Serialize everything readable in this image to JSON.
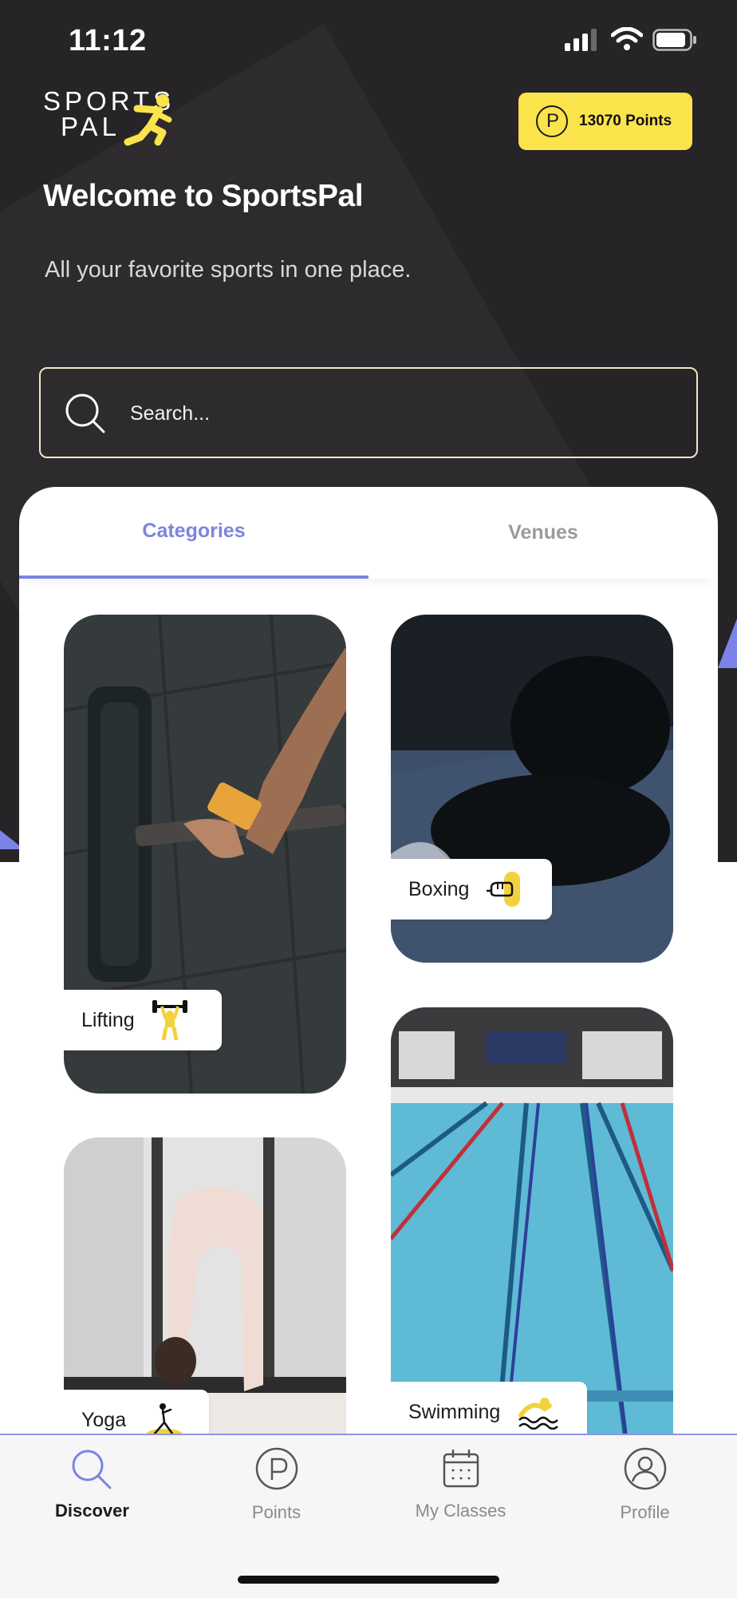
{
  "status_bar": {
    "time": "11:12"
  },
  "brand": {
    "logo_line1": "SPORTS",
    "logo_line2": "PAL",
    "accent": "#fbe34b",
    "primary": "#7b84df",
    "dark_bg": "#262427"
  },
  "header": {
    "points_label": "13070 Points",
    "points_icon_glyph": "P",
    "welcome": "Welcome to SportsPal",
    "subtitle": "All your favorite sports in one place."
  },
  "search": {
    "placeholder": "Search...",
    "value": ""
  },
  "tabs": [
    {
      "label": "Categories",
      "active": true
    },
    {
      "label": "Venues",
      "active": false
    }
  ],
  "categories": [
    {
      "label": "Lifting",
      "icon": "weightlifter-icon"
    },
    {
      "label": "Boxing",
      "icon": "boxing-glove-icon"
    },
    {
      "label": "Yoga",
      "icon": "yoga-pose-icon"
    },
    {
      "label": "Swimming",
      "icon": "swimmer-icon"
    }
  ],
  "bottom_nav": [
    {
      "label": "Discover",
      "icon": "search-icon",
      "active": true
    },
    {
      "label": "Points",
      "icon": "points-icon",
      "active": false
    },
    {
      "label": "My Classes",
      "icon": "calendar-icon",
      "active": false
    },
    {
      "label": "Profile",
      "icon": "profile-icon",
      "active": false
    }
  ]
}
